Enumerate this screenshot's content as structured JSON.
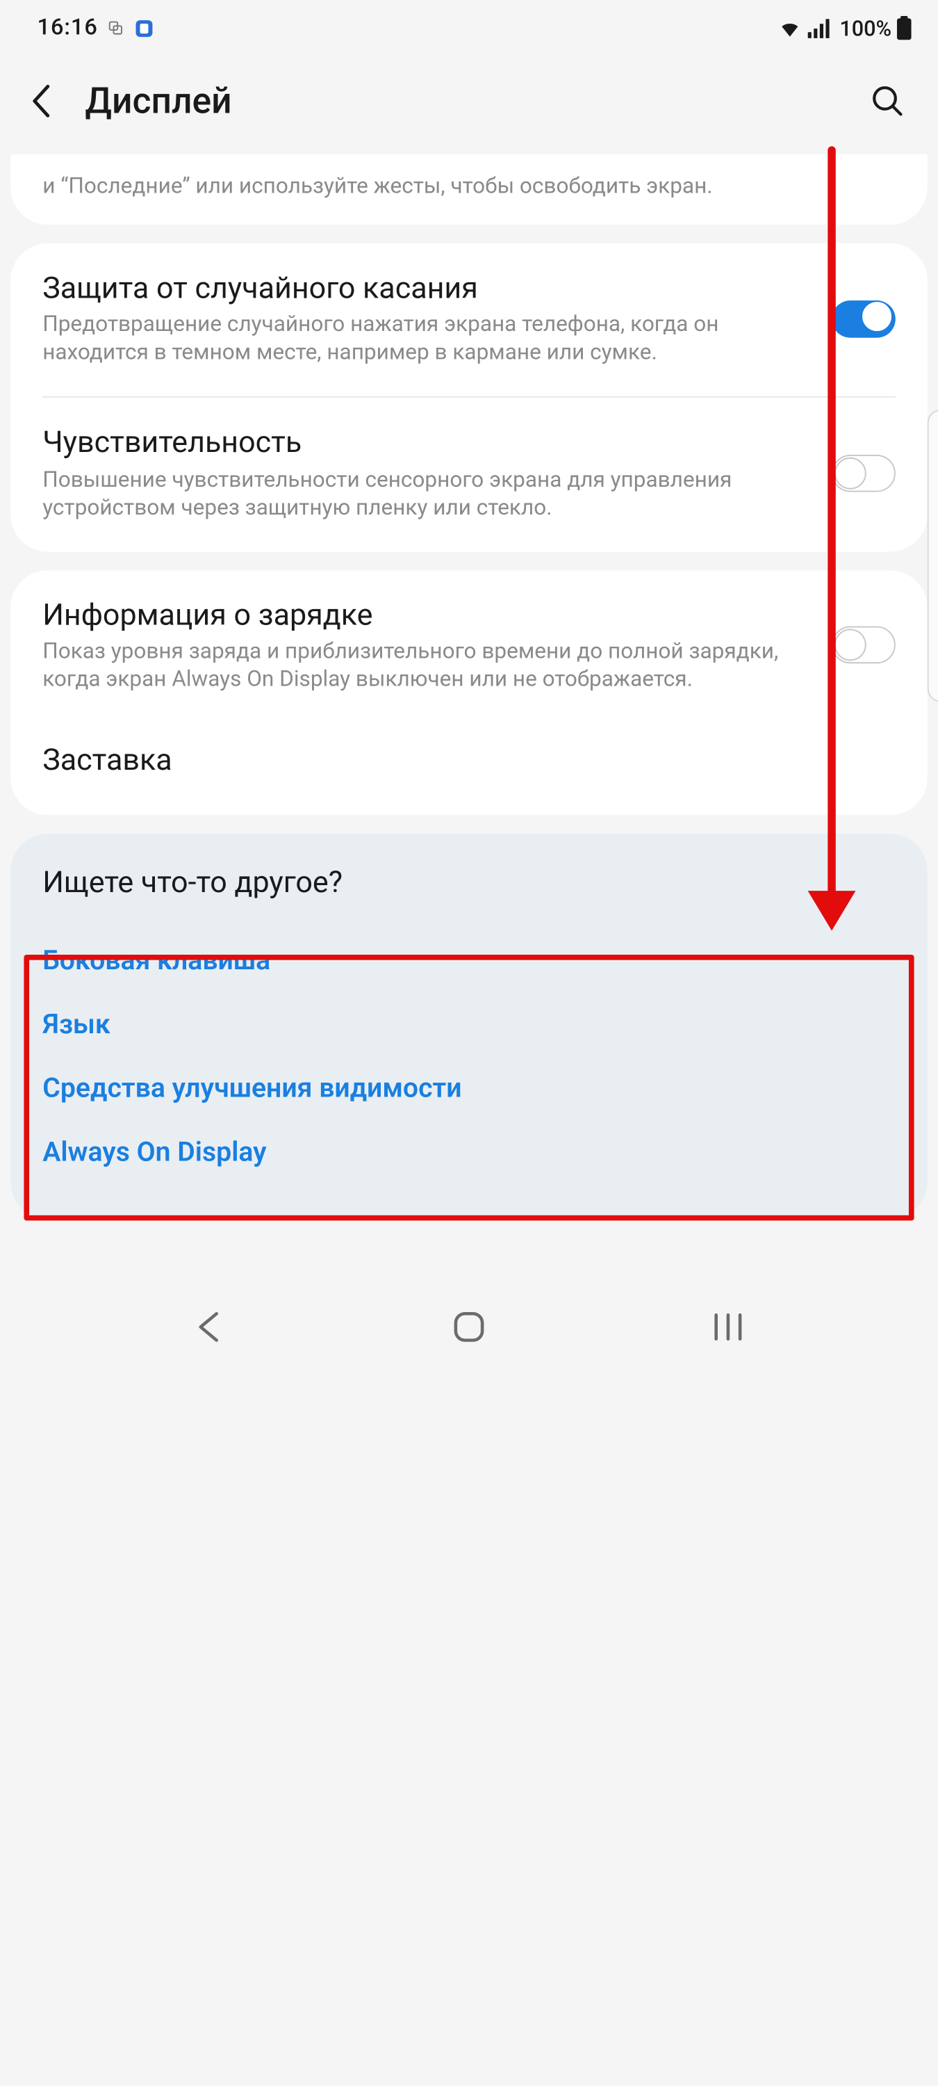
{
  "status": {
    "time": "16:16",
    "battery_pct": "100%"
  },
  "header": {
    "title": "Дисплей"
  },
  "partial_row": {
    "desc": "и “Последние” или используйте жесты, чтобы освободить экран."
  },
  "card1": {
    "item1": {
      "title": "Защита от случайного касания",
      "desc": "Предотвращение случайного нажатия экрана телефона, когда он находится в темном месте, например в кармане или сумке.",
      "toggle": true
    },
    "item2": {
      "title": "Чувствительность",
      "desc": "Повышение чувствительности сенсорного экрана для управления устройством через защитную пленку или стекло.",
      "toggle": false
    }
  },
  "card2": {
    "item1": {
      "title": "Информация о зарядке",
      "desc": "Показ уровня заряда и приблизительного времени до полной зарядки, когда экран Always On Display выключен или не отображается.",
      "toggle": false
    },
    "item2": {
      "title": "Заставка"
    }
  },
  "suggest": {
    "title": "Ищете что-то другое?",
    "links": [
      "Боковая клавиша",
      "Язык",
      "Средства улучшения видимости",
      "Always On Display"
    ]
  },
  "colors": {
    "accent_blue": "#1a7fe0",
    "annotation_red": "#e30c0c",
    "bg": "#f5f5f5"
  }
}
